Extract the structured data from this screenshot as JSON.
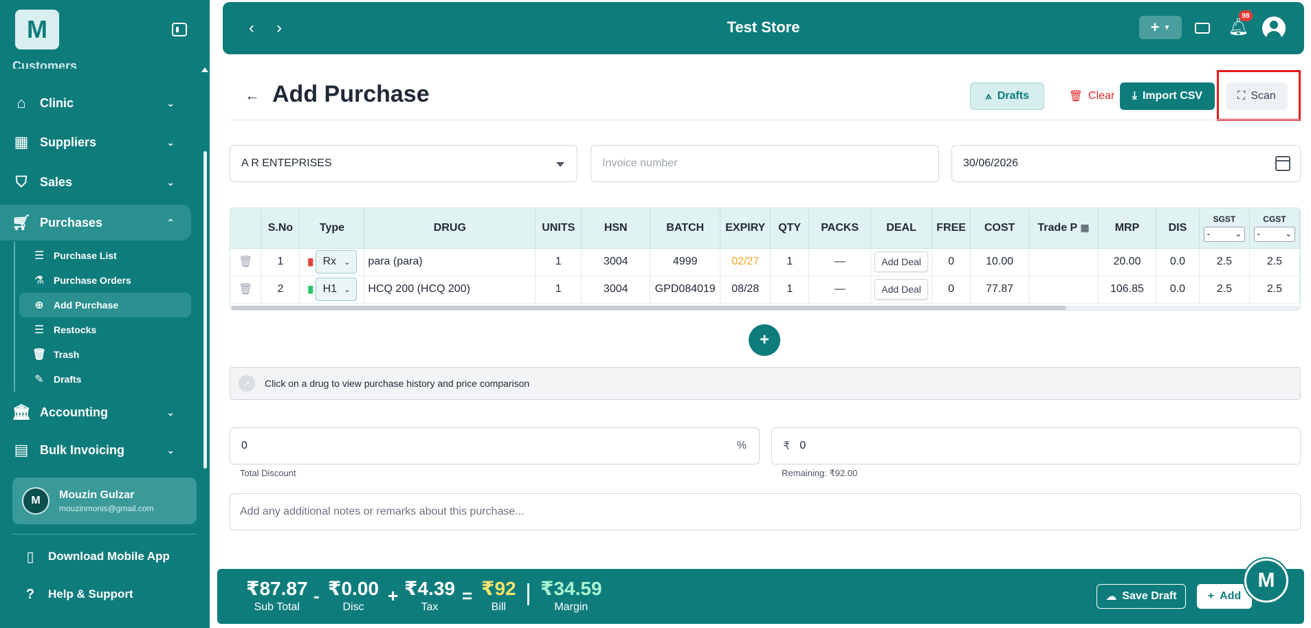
{
  "sidebar": {
    "logo": "M",
    "cut_item": "Customers",
    "items": [
      {
        "label": "Clinic"
      },
      {
        "label": "Suppliers"
      },
      {
        "label": "Sales"
      },
      {
        "label": "Purchases"
      },
      {
        "label": "Accounting"
      },
      {
        "label": "Bulk Invoicing"
      }
    ],
    "sub_items": [
      {
        "label": "Purchase List"
      },
      {
        "label": "Purchase Orders"
      },
      {
        "label": "Add Purchase"
      },
      {
        "label": "Restocks"
      },
      {
        "label": "Trash"
      },
      {
        "label": "Drafts"
      }
    ],
    "user": {
      "initial": "M",
      "name": "Mouzin Gulzar",
      "email": "mouzinmonis@gmail.com"
    },
    "download": "Download Mobile App",
    "help": "Help & Support"
  },
  "header": {
    "title": "Test Store",
    "notification_count": "98"
  },
  "page": {
    "title": "Add Purchase",
    "drafts": "Drafts",
    "clear": "Clear",
    "import_csv": "Import CSV",
    "scan": "Scan"
  },
  "form": {
    "supplier": "A R ENTEPRISES",
    "invoice_placeholder": "Invoice number",
    "date": "30/06/2026"
  },
  "table": {
    "headers": [
      "S.No",
      "Type",
      "DRUG",
      "UNITS",
      "HSN",
      "BATCH",
      "EXPIRY",
      "QTY",
      "PACKS",
      "DEAL",
      "FREE",
      "COST",
      "Trade P",
      "MRP",
      "DIS",
      "SGST",
      "CGST"
    ],
    "mini_select": "-",
    "rows": [
      {
        "sno": "1",
        "type": "Rx",
        "bar_color": "#e53935",
        "drug": "para (para)",
        "units": "1",
        "hsn": "3004",
        "batch": "4999",
        "expiry": "02/27",
        "expiry_color": "#f5a623",
        "qty": "1",
        "packs": "—",
        "deal": "Add Deal",
        "free": "0",
        "cost": "10.00",
        "trade": "",
        "mrp": "20.00",
        "dis": "0.0",
        "sgst": "2.5",
        "cgst": "2.5"
      },
      {
        "sno": "2",
        "type": "H1",
        "bar_color": "#22c55e",
        "drug": "HCQ 200 (HCQ 200)",
        "units": "1",
        "hsn": "3004",
        "batch": "GPD084019",
        "expiry": "08/28",
        "expiry_color": "#1f2937",
        "qty": "1",
        "packs": "—",
        "deal": "Add Deal",
        "free": "0",
        "cost": "77.87",
        "trade": "",
        "mrp": "106.85",
        "dis": "0.0",
        "sgst": "2.5",
        "cgst": "2.5"
      }
    ]
  },
  "info_text": "Click on a drug to view purchase history and price comparison",
  "discount": {
    "percent_value": "0",
    "percent_symbol": "%",
    "amount_symbol": "₹",
    "amount_value": "0",
    "total_label": "Total Discount",
    "remaining": "Remaining: ₹92.00"
  },
  "notes_placeholder": "Add any additional notes or remarks about this purchase...",
  "footer": {
    "subtotal": "₹87.87",
    "subtotal_label": "Sub Total",
    "disc": "₹0.00",
    "disc_label": "Disc",
    "tax": "₹4.39",
    "tax_label": "Tax",
    "bill": "₹92",
    "bill_label": "Bill",
    "margin": "₹34.59",
    "margin_label": "Margin",
    "op_minus": "-",
    "op_plus": "+",
    "op_eq": "=",
    "op_sep": "|",
    "save_draft": "Save Draft",
    "add": "Add"
  },
  "fab_label": "M",
  "colors": {
    "primary": "#0f7c7c",
    "bill_yellow": "#f7e26b",
    "margin_green": "#a7f3d0",
    "danger": "#dc2626",
    "highlight": "#e21b1b"
  }
}
